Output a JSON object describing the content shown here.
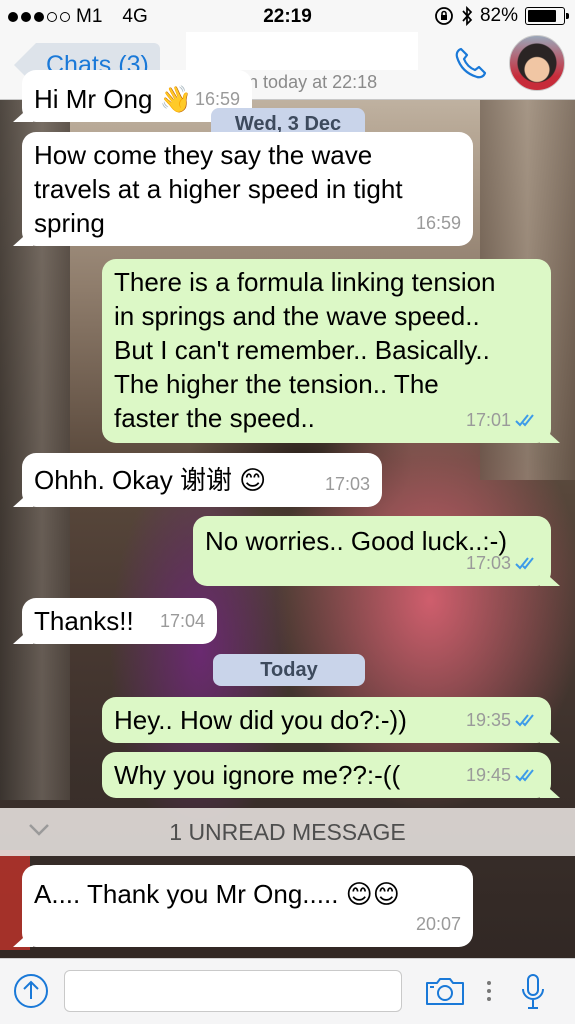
{
  "status_bar": {
    "carrier": "M1",
    "network": "4G",
    "time": "22:19",
    "battery": "82%",
    "battery_level": 0.82
  },
  "header": {
    "back_label": "Chats (3)",
    "contact_name": "",
    "last_seen": "last seen today at 22:18"
  },
  "messages": [
    {
      "side": "in",
      "text": "Hi Mr Ong 👋",
      "time": "16:59"
    },
    {
      "side": "in",
      "text": "How come they say the wave\ntravels at a higher speed in tight\nspring",
      "time": "16:59"
    },
    {
      "side": "out",
      "text": "There is a formula linking tension\nin springs and the wave speed..\nBut I can't remember.. Basically..\nThe higher the tension.. The\nfaster the speed..",
      "time": "17:01",
      "read": true
    },
    {
      "side": "in",
      "text": "Ohhh. Okay 谢谢 😊",
      "time": "17:03"
    },
    {
      "side": "out",
      "text": "No worries.. Good luck..:-)",
      "time": "17:03",
      "read": true
    },
    {
      "side": "in",
      "text": "Thanks!!",
      "time": "17:04"
    },
    {
      "side": "out",
      "text": "Hey.. How did you do?:-))",
      "time": "19:35",
      "read": true
    },
    {
      "side": "out",
      "text": "Why you ignore me??:-((",
      "time": "19:45",
      "read": true
    },
    {
      "side": "in",
      "text": "A.... Thank you Mr Ong..... 😊😊",
      "time": "20:07"
    }
  ],
  "date_separators": [
    "Wed, 3 Dec",
    "Today"
  ],
  "unread_banner": "1 UNREAD MESSAGE",
  "input": {
    "placeholder": ""
  },
  "colors": {
    "incoming_bubble": "#ffffff",
    "outgoing_bubble": "#dcf8c6",
    "accent": "#1a79d8",
    "read_check": "#3d9be9"
  }
}
